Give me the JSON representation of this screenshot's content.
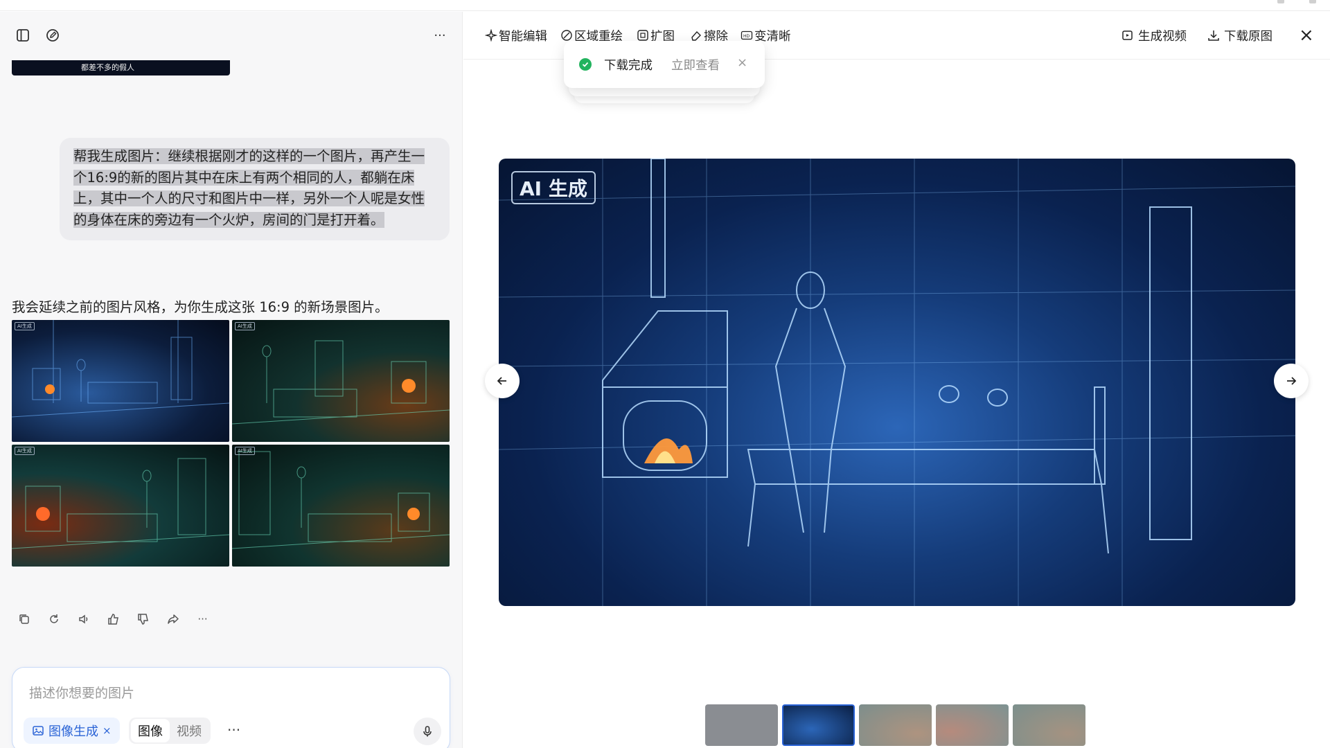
{
  "window": {
    "accent": "#2a63d6"
  },
  "left": {
    "icons": [
      "sidebar-toggle-icon",
      "new-chat-icon",
      "more-icon"
    ],
    "prev_thumb_caption": "都差不多的假人",
    "user_message_lines": [
      "帮我生成图片：继续根据刚才的这样的一个图片，再产生一",
      "个16:9的新的图片其中在床上有两个相同的人，都躺在床",
      "上，其中一个人的尺寸和图片中一样，另外一个人呢是女性",
      "的身体在床的旁边有一个火炉，房间的门是打开着。"
    ],
    "assistant_reply": "我会延续之前的图片风格，为你生成这张 16:9 的新场景图片。",
    "image_badge": "AI生成",
    "grid_images": [
      {
        "name": "blue-bedroom-fireplace-left"
      },
      {
        "name": "green-bedroom-fireplace-right"
      },
      {
        "name": "teal-bedroom-fireplace-left"
      },
      {
        "name": "green-bedroom-door-left"
      }
    ],
    "message_actions": [
      "copy-icon",
      "regenerate-icon",
      "read-aloud-icon",
      "thumbs-up-icon",
      "thumbs-down-icon",
      "share-icon",
      "more-icon"
    ],
    "composer": {
      "placeholder": "描述你想要的图片",
      "mode_chip": "图像生成",
      "seg_image": "图像",
      "seg_video": "视频",
      "more": "···"
    }
  },
  "right": {
    "tools": {
      "smart_edit": "智能编辑",
      "region_repaint": "区域重绘",
      "expand": "扩图",
      "erase": "擦除",
      "upscale": "变清晰"
    },
    "generate_video": "生成视频",
    "download_original": "下载原图",
    "toast": {
      "status": "下载完成",
      "action": "立即查看"
    },
    "main_badge": "AI 生成",
    "thumbnails_count": 5,
    "active_thumbnail": 2
  }
}
